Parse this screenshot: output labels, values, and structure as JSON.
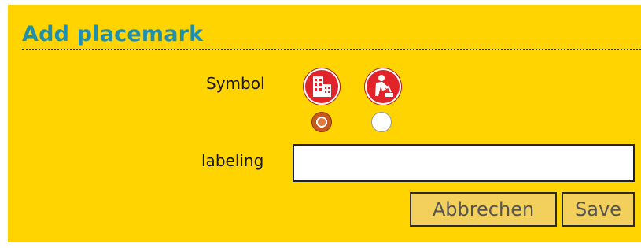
{
  "dialog": {
    "title": "Add placemark",
    "symbol_label": "Symbol",
    "symbols": [
      {
        "icon": "building-icon",
        "selected": true
      },
      {
        "icon": "construction-worker-icon",
        "selected": false
      }
    ],
    "labeling_label": "labeling",
    "labeling_value": "",
    "buttons": {
      "cancel": "Abbrechen",
      "save": "Save"
    }
  },
  "colors": {
    "background": "#ffd400",
    "title": "#1f8fb0",
    "symbol_badge": "#e0242a",
    "button_bg": "#f3cf5c"
  }
}
